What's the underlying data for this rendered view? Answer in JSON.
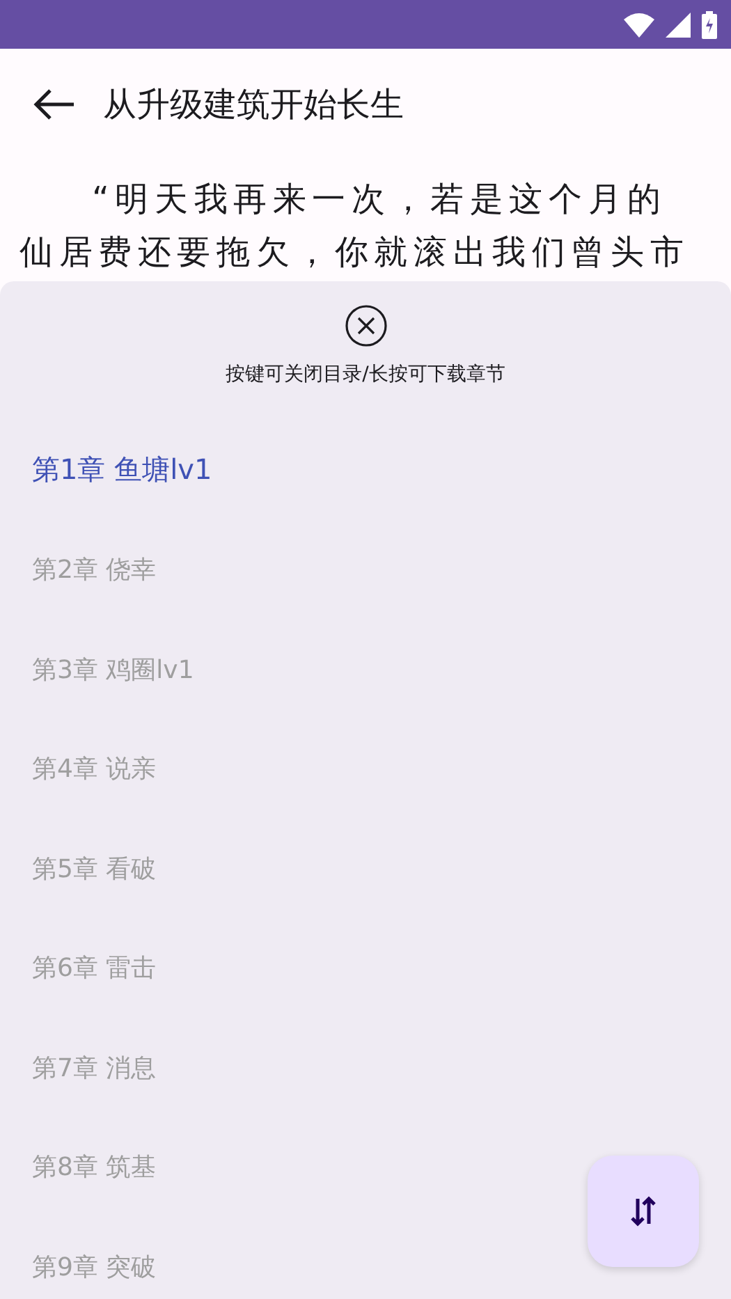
{
  "app_bar": {
    "title": "从升级建筑开始长生"
  },
  "content": {
    "paragraphs": [
      "“明天我再来一次，若是这个月的",
      "仙居费还要拖欠，你就滚出我们曾头市"
    ]
  },
  "chapter_sheet": {
    "hint": "按键可关闭目录/长按可下载章节",
    "chapters": [
      {
        "title": "第1章 鱼塘lv1",
        "selected": true
      },
      {
        "title": "第2章 侥幸",
        "selected": false
      },
      {
        "title": "第3章 鸡圈lv1",
        "selected": false
      },
      {
        "title": "第4章 说亲",
        "selected": false
      },
      {
        "title": "第5章 看破",
        "selected": false
      },
      {
        "title": "第6章 雷击",
        "selected": false
      },
      {
        "title": "第7章 消息",
        "selected": false
      },
      {
        "title": "第8章 筑基",
        "selected": false
      },
      {
        "title": "第9章 突破",
        "selected": false
      }
    ]
  }
}
